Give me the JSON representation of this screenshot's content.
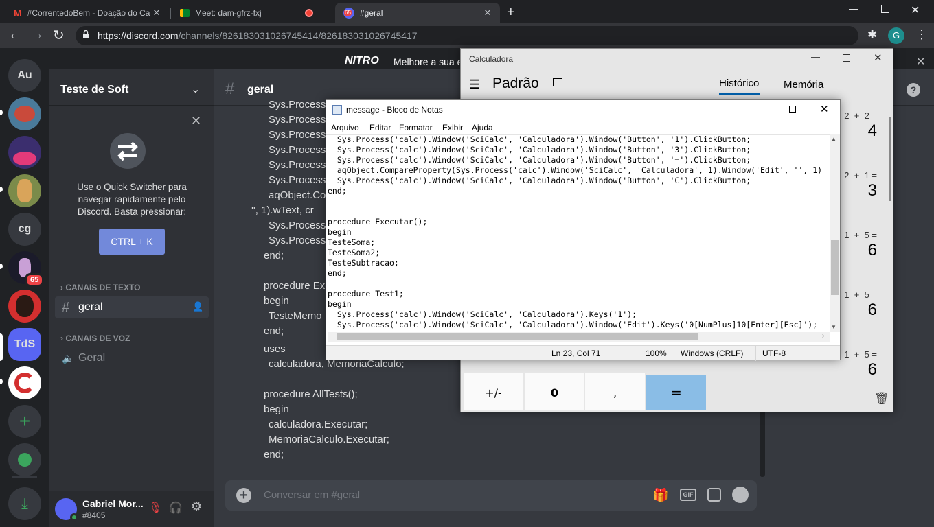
{
  "browser": {
    "tabs": [
      {
        "title": "#CorrentedoBem - Doação do Ca"
      },
      {
        "title": "Meet: dam-gfrz-fxj"
      },
      {
        "title": "#geral",
        "badge": "65"
      }
    ],
    "url_host": "https://discord.com",
    "url_path": "/channels/826183031026745414/826183031026745417",
    "profile_initial": "G"
  },
  "discord": {
    "nitro_label": "NITRO",
    "nitro_text": "Melhore a sua ex",
    "servers": [
      {
        "label": "Au"
      },
      {
        "label": "cg"
      },
      {
        "label": "TdS"
      }
    ],
    "server_badge": "65",
    "server_name": "Teste de Soft",
    "quick_switcher": {
      "text": "Use o Quick Switcher para navegar rapidamente pelo Discord. Basta pressionar:",
      "button": "CTRL + K"
    },
    "text_category": "CANAIS DE TEXTO",
    "text_channel": "geral",
    "voice_category": "CANAIS DE VOZ",
    "voice_channel": "Geral",
    "user": {
      "name": "Gabriel Mor...",
      "tag": "#8405"
    },
    "chat_header": "geral",
    "message_placeholder": "Conversar em #geral",
    "code_lines": [
      "Sys.Process(",
      "Sys.Process(",
      "Sys.Process(",
      "Sys.Process(",
      "Sys.Process(",
      "Sys.Process(",
      "aqObject.Co",
      "'', 1).wText, cr",
      "Sys.Process(",
      "Sys.Process(",
      "end;",
      "",
      "procedure Exe",
      "begin",
      "TesteMemo",
      "end;",
      "uses",
      "calculadora, MemoriaCalculo;",
      "",
      "procedure AllTests();",
      "begin",
      "calculadora.Executar;",
      "MemoriaCalculo.Executar;",
      "end;"
    ]
  },
  "calculator": {
    "title": "Calculadora",
    "mode": "Padrão",
    "tab_history": "Histórico",
    "tab_memory": "Memória",
    "history": [
      {
        "expr": "2  +  2 =",
        "result": "4"
      },
      {
        "expr": "2  +  1 =",
        "result": "3"
      },
      {
        "expr": "1  +  5 =",
        "result": "6"
      },
      {
        "expr": "1  +  5 =",
        "result": "6"
      },
      {
        "expr": "1  +  5 =",
        "result": "6"
      }
    ],
    "keys": [
      "+/-",
      "0",
      ",",
      "="
    ]
  },
  "notepad": {
    "title": "message - Bloco de Notas",
    "menu": [
      "Arquivo",
      "Editar",
      "Formatar",
      "Exibir",
      "Ajuda"
    ],
    "lines": [
      "  Sys.Process('calc').Window('SciCalc', 'Calculadora').Window('Button', '1').ClickButton;",
      "  Sys.Process('calc').Window('SciCalc', 'Calculadora').Window('Button', '3').ClickButton;",
      "  Sys.Process('calc').Window('SciCalc', 'Calculadora').Window('Button', '=').ClickButton;",
      "  aqObject.CompareProperty(Sys.Process('calc').Window('SciCalc', 'Calculadora', 1).Window('Edit', '', 1)",
      "  Sys.Process('calc').Window('SciCalc', 'Calculadora').Window('Button', 'C').ClickButton;",
      "end;",
      "",
      "",
      "procedure Executar();",
      "begin",
      "TesteSoma;",
      "TesteSoma2;",
      "TesteSubtracao;",
      "end;",
      "",
      "procedure Test1;",
      "begin",
      "  Sys.Process('calc').Window('SciCalc', 'Calculadora').Keys('1');",
      "  Sys.Process('calc').Window('SciCalc', 'Calculadora').Window('Edit').Keys('0[NumPlus]10[Enter][Esc]');"
    ],
    "status": {
      "position": "Ln 23, Col 71",
      "zoom": "100%",
      "eol": "Windows (CRLF)",
      "encoding": "UTF-8"
    }
  }
}
